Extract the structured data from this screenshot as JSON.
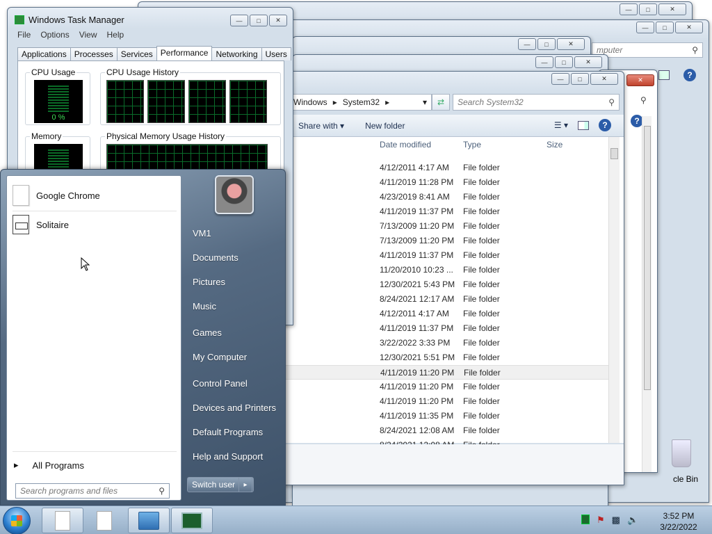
{
  "background_windows": {
    "partial_search_text": "mputer",
    "partial_status_text": "PM"
  },
  "explorer": {
    "breadcrumb": [
      "Windows",
      "System32"
    ],
    "search_placeholder": "Search System32",
    "toolbar": {
      "share_with": "Share with",
      "new_folder": "New folder"
    },
    "columns": {
      "date_modified": "Date modified",
      "type": "Type",
      "size": "Size"
    },
    "rows": [
      {
        "date": "4/12/2011 4:17 AM",
        "type": "File folder"
      },
      {
        "date": "4/11/2019 11:28 PM",
        "type": "File folder"
      },
      {
        "date": "4/23/2019 8:41 AM",
        "type": "File folder"
      },
      {
        "date": "4/11/2019 11:37 PM",
        "type": "File folder"
      },
      {
        "date": "7/13/2009 11:20 PM",
        "type": "File folder"
      },
      {
        "date": "7/13/2009 11:20 PM",
        "type": "File folder"
      },
      {
        "date": "4/11/2019 11:37 PM",
        "type": "File folder"
      },
      {
        "date": "11/20/2010 10:23 ...",
        "type": "File folder"
      },
      {
        "date": "12/30/2021 5:43 PM",
        "type": "File folder"
      },
      {
        "date": "8/24/2021 12:17 AM",
        "type": "File folder"
      },
      {
        "date": "4/12/2011 4:17 AM",
        "type": "File folder"
      },
      {
        "date": "4/11/2019 11:37 PM",
        "type": "File folder"
      },
      {
        "date": "3/22/2022 3:33 PM",
        "type": "File folder"
      },
      {
        "date": "12/30/2021 5:51 PM",
        "type": "File folder"
      },
      {
        "date": "4/11/2019 11:20 PM",
        "type": "File folder"
      },
      {
        "date": "4/11/2019 11:20 PM",
        "type": "File folder"
      },
      {
        "date": "4/11/2019 11:20 PM",
        "type": "File folder"
      },
      {
        "date": "4/11/2019 11:35 PM",
        "type": "File folder"
      },
      {
        "date": "8/24/2021 12:08 AM",
        "type": "File folder"
      },
      {
        "date": "8/24/2021 12:08 AM",
        "type": "File folder"
      }
    ],
    "selected_row_index": 14
  },
  "task_manager": {
    "title": "Windows Task Manager",
    "menu": [
      "File",
      "Options",
      "View",
      "Help"
    ],
    "tabs": [
      "Applications",
      "Processes",
      "Services",
      "Performance",
      "Networking",
      "Users"
    ],
    "active_tab": "Performance",
    "cpu_usage_label": "CPU Usage",
    "cpu_usage_value": "0 %",
    "cpu_history_label": "CPU Usage History",
    "memory_label": "Memory",
    "memory_history_label": "Physical Memory Usage History",
    "graph_color": "#33d04d"
  },
  "start_menu": {
    "pinned": [
      {
        "label": "Google Chrome",
        "icon": "document-icon"
      },
      {
        "label": "Solitaire",
        "icon": "solitaire-icon"
      }
    ],
    "all_programs": "All Programs",
    "search_placeholder": "Search programs and files",
    "right_items": [
      "VM1",
      "Documents",
      "Pictures",
      "Music",
      "Games",
      "My Computer",
      "Control Panel",
      "Devices and Printers",
      "Default Programs",
      "Help and Support"
    ],
    "switch_user": "Switch user"
  },
  "desktop": {
    "recycle_bin_label": "cle Bin"
  },
  "taskbar": {
    "clock_time": "3:52 PM",
    "clock_date": "3/22/2022"
  }
}
